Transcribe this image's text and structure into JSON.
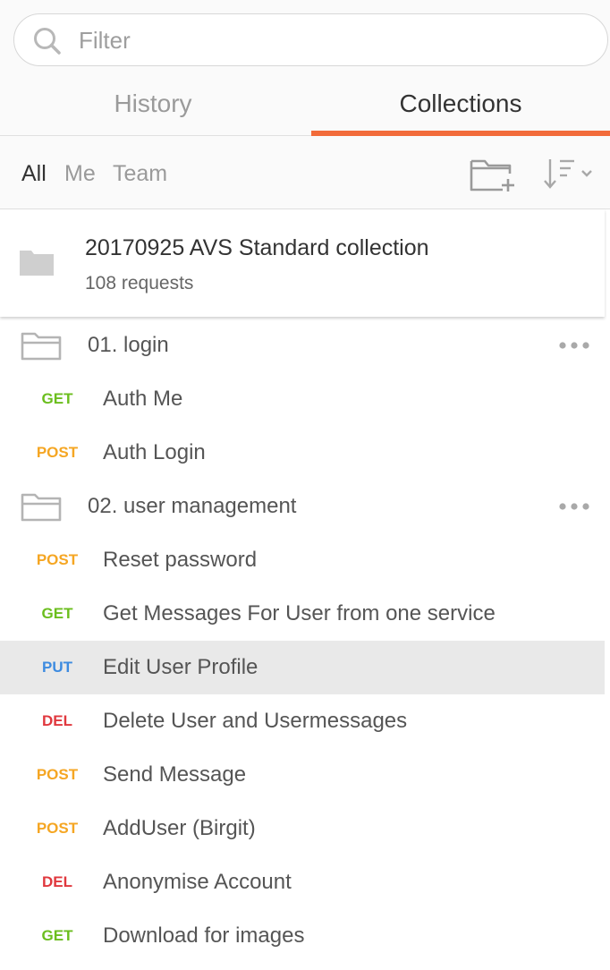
{
  "search": {
    "placeholder": "Filter",
    "value": ""
  },
  "tabs": [
    {
      "label": "History",
      "active": false
    },
    {
      "label": "Collections",
      "active": true
    }
  ],
  "filter_tabs": [
    {
      "label": "All",
      "active": true
    },
    {
      "label": "Me",
      "active": false
    },
    {
      "label": "Team",
      "active": false
    }
  ],
  "toolbar": {
    "new_folder_icon": "folder-plus-icon",
    "sort_icon": "sort-descending-icon"
  },
  "collection": {
    "name": "20170925 AVS Standard collection",
    "count": "108 requests",
    "icon": "folder-filled-icon"
  },
  "colors": {
    "accent": "#f26b3a",
    "GET": "#6bbe1e",
    "POST": "#f5a623",
    "PUT": "#3d8be0",
    "DEL": "#e0383e"
  },
  "tree": [
    {
      "type": "folder",
      "name": "01. login"
    },
    {
      "type": "request",
      "method": "GET",
      "name": "Auth Me"
    },
    {
      "type": "request",
      "method": "POST",
      "name": "Auth Login"
    },
    {
      "type": "folder",
      "name": "02. user management"
    },
    {
      "type": "request",
      "method": "POST",
      "name": "Reset password"
    },
    {
      "type": "request",
      "method": "GET",
      "name": "Get Messages For User from one service"
    },
    {
      "type": "request",
      "method": "PUT",
      "name": "Edit User Profile",
      "active": true
    },
    {
      "type": "request",
      "method": "DEL",
      "name": "Delete User and Usermessages"
    },
    {
      "type": "request",
      "method": "POST",
      "name": "Send Message"
    },
    {
      "type": "request",
      "method": "POST",
      "name": "AddUser (Birgit)"
    },
    {
      "type": "request",
      "method": "DEL",
      "name": "Anonymise Account"
    },
    {
      "type": "request",
      "method": "GET",
      "name": "Download for images"
    }
  ]
}
